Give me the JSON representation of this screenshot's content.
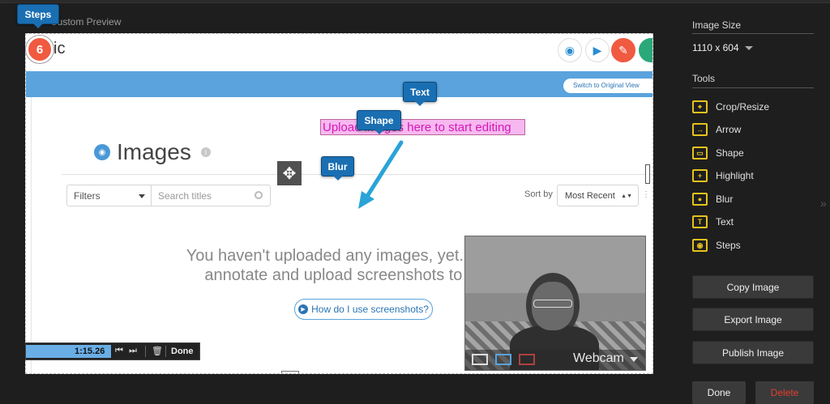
{
  "preview": {
    "label": "Custom Preview"
  },
  "canvas": {
    "header": {
      "logo_fragment": "ic"
    },
    "switch_label": "Switch to Original View",
    "images_title": "Images",
    "filters_label": "Filters",
    "search_placeholder": "Search titles",
    "sort_by_label": "Sort by",
    "sort_value": "Most Recent",
    "empty_message": "You haven't uploaded any images, yet. Capture, annotate and upload screenshots to share.",
    "howto_link": "How do I use screenshots?"
  },
  "annotations": {
    "steps_callout": "Steps",
    "step_number": "6",
    "text_callout": "Text",
    "shape_callout": "Shape",
    "blur_callout": "Blur",
    "highlight_text": "Upload images here to start editing",
    "arrow_color": "#2aa3d8"
  },
  "webcam": {
    "label": "Webcam"
  },
  "timer": {
    "time": "1:15.26",
    "done_label": "Done",
    "progress": 0.49
  },
  "panel": {
    "image_size_title": "Image Size",
    "image_size_value": "1110 x 604",
    "tools_title": "Tools",
    "tools": [
      {
        "label": "Crop/Resize",
        "icon": "crop-icon"
      },
      {
        "label": "Arrow",
        "icon": "arrow-icon"
      },
      {
        "label": "Shape",
        "icon": "shape-icon"
      },
      {
        "label": "Highlight",
        "icon": "highlight-icon"
      },
      {
        "label": "Blur",
        "icon": "blur-icon"
      },
      {
        "label": "Text",
        "icon": "text-icon"
      },
      {
        "label": "Steps",
        "icon": "steps-icon"
      }
    ],
    "copy_label": "Copy Image",
    "export_label": "Export Image",
    "publish_label": "Publish Image",
    "done_label": "Done",
    "delete_label": "Delete"
  },
  "colors": {
    "accent": "#e6c21c",
    "callout": "#1a6fb3",
    "step_badge": "#f05a40",
    "delete": "#e04030"
  }
}
